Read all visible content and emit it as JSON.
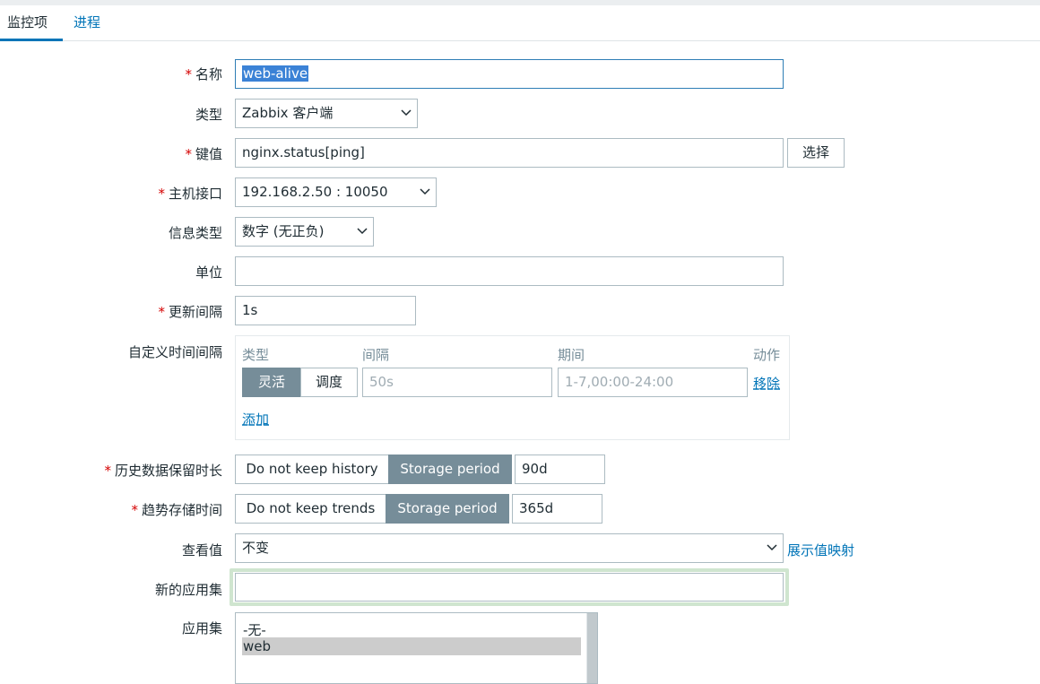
{
  "tabs": [
    {
      "label": "监控项",
      "active": true
    },
    {
      "label": "进程",
      "active": false
    }
  ],
  "form": {
    "name": {
      "label": "名称",
      "value": "web-alive"
    },
    "type": {
      "label": "类型",
      "value": "Zabbix 客户端"
    },
    "key": {
      "label": "键值",
      "value": "nginx.status[ping]",
      "button": "选择"
    },
    "interface": {
      "label": "主机接口",
      "value": "192.168.2.50 : 10050"
    },
    "info_type": {
      "label": "信息类型",
      "value": "数字 (无正负)"
    },
    "units": {
      "label": "单位",
      "value": ""
    },
    "update_interval": {
      "label": "更新间隔",
      "value": "1s"
    },
    "custom_intervals": {
      "label": "自定义时间间隔",
      "headers": {
        "type": "类型",
        "interval": "间隔",
        "period": "期间",
        "action": "动作"
      },
      "row": {
        "type_options": [
          "灵活",
          "调度"
        ],
        "type_selected": "灵活",
        "interval_placeholder": "50s",
        "period_placeholder": "1-7,00:00-24:00",
        "remove": "移除"
      },
      "add": "添加"
    },
    "history": {
      "label": "历史数据保留时长",
      "option_off": "Do not keep history",
      "option_on": "Storage period",
      "value": "90d"
    },
    "trends": {
      "label": "趋势存储时间",
      "option_off": "Do not keep trends",
      "option_on": "Storage period",
      "value": "365d"
    },
    "valuemap": {
      "label": "查看值",
      "value": "不变",
      "link": "展示值映射"
    },
    "new_application": {
      "label": "新的应用集",
      "value": ""
    },
    "applications": {
      "label": "应用集",
      "options": [
        "-无-",
        "web"
      ],
      "selected": "web"
    }
  },
  "colors": {
    "link": "#0275b8",
    "required": "#d40000",
    "segment_active": "#768d99",
    "focus_ring": "#cfe5cf"
  }
}
